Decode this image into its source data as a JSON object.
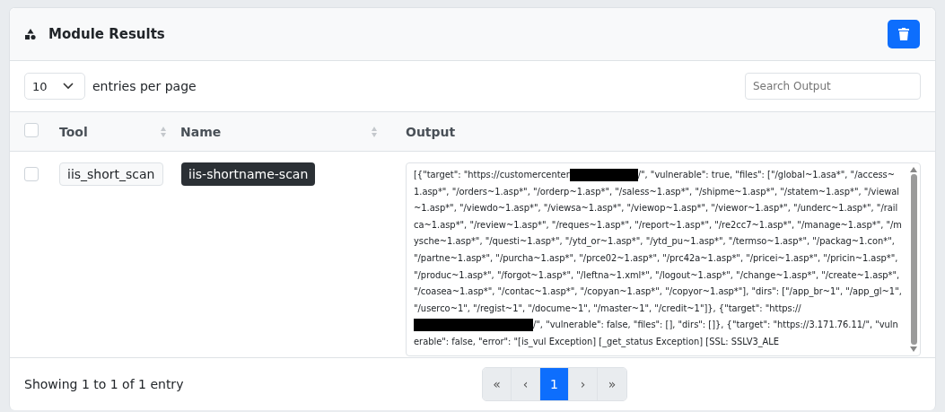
{
  "card": {
    "title": "Module Results"
  },
  "controls": {
    "per_page": "10",
    "per_page_label": "entries per page",
    "search": {
      "placeholder": "Search Output"
    }
  },
  "table": {
    "select_all": {
      "checked": false
    },
    "columns": [
      {
        "label": "Tool",
        "sortable": true
      },
      {
        "label": "Name",
        "sortable": true
      },
      {
        "label": "Output",
        "sortable": false
      }
    ],
    "rows": [
      {
        "checked": false,
        "tool": "iis_short_scan",
        "name": "iis-shortname-scan",
        "output": [
          {
            "kind": "text",
            "text": "[{\"target\": \"https://customercenter"
          },
          {
            "kind": "redacted"
          },
          {
            "kind": "text",
            "text": "/\", \"vulnerable\": true, \"files\": [\"/global~1.asa*\", \"/access~1.asp*\", \"/orders~1.asp*\", \"/orderp~1.asp*\", \"/saless~1.asp*\", \"/shipme~1.asp*\", \"/statem~1.asp*\", \"/viewal~1.asp*\", \"/viewdo~1.asp*\", \"/viewsa~1.asp*\", \"/viewop~1.asp*\", \"/viewor~1.asp*\", \"/underc~1.asp*\", \"/railca~1.asp*\", \"/review~1.asp*\", \"/reques~1.asp*\", \"/report~1.asp*\", \"/re2cc7~1.asp*\", \"/manage~1.asp*\", \"/mysche~1.asp*\", \"/questi~1.asp*\", \"/ytd_or~1.asp*\", \"/ytd_pu~1.asp*\", \"/termso~1.asp*\", \"/packag~1.con*\", \"/partne~1.asp*\", \"/purcha~1.asp*\", \"/prce02~1.asp*\", \"/prc42a~1.asp*\", \"/pricei~1.asp*\", \"/pricin~1.asp*\", \"/produc~1.asp*\", \"/forgot~1.asp*\", \"/leftna~1.xml*\", \"/logout~1.asp*\", \"/change~1.asp*\", \"/create~1.asp*\", \"/coasea~1.asp*\", \"/contac~1.asp*\", \"/copyan~1.asp*\", \"/copyor~1.asp*\"], \"dirs\": [\"/app_br~1\", \"/app_gl~1\", \"/userco~1\", \"/regist~1\", \"/docume~1\", \"/master~1\", \"/credit~1\"]}, {\"target\": \"https://"
          },
          {
            "kind": "redacted"
          },
          {
            "kind": "text",
            "text": "/\", \"vulnerable\": false, \"files\": [], \"dirs\": []}, {\"target\": \"https://3.171.76.11/\", \"vulnerable\": false, \"error\": \"[is_vul Exception] [_get_status Exception] [SSL: SSLV3_ALE"
          }
        ]
      }
    ]
  },
  "footer": {
    "info": "Showing 1 to 1 of 1 entry",
    "pages": [
      {
        "label": "«",
        "selected": false
      },
      {
        "label": "‹",
        "selected": false
      },
      {
        "label": "1",
        "selected": true
      },
      {
        "label": "›",
        "selected": false
      },
      {
        "label": "»",
        "selected": false
      }
    ]
  }
}
